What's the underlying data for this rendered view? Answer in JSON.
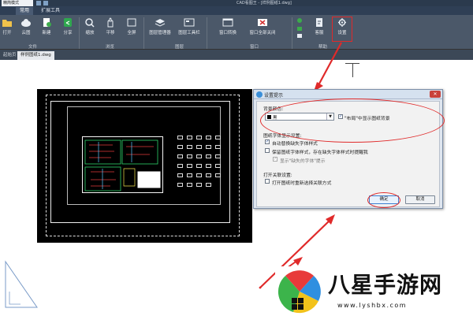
{
  "titlebar": {
    "dropdown_value": "精简模式",
    "title": "CAD看图王 - [样例图纸1.dwg]"
  },
  "ribbon_tabs": [
    {
      "label": "常用"
    },
    {
      "label": "扩展工具"
    }
  ],
  "ribbon": {
    "buttons": [
      {
        "label": "打开",
        "icon": "folder-icon"
      },
      {
        "label": "云图",
        "icon": "cloud-icon"
      },
      {
        "label": "新建",
        "icon": "new-file-icon"
      },
      {
        "label": "分享",
        "icon": "share-icon"
      },
      {
        "label": "缩放",
        "icon": "zoom-icon"
      },
      {
        "label": "平移",
        "icon": "hand-icon"
      },
      {
        "label": "全屏",
        "icon": "fullscreen-icon"
      },
      {
        "label": "图层管理器",
        "icon": "layers-icon"
      },
      {
        "label": "图层工具栏",
        "icon": "layer-toolbar-icon"
      },
      {
        "label": "窗口转换",
        "icon": "window-switch-icon"
      },
      {
        "label": "窗口全部关闭",
        "icon": "close-all-icon"
      },
      {
        "label": "客服",
        "icon": "support-icon"
      },
      {
        "label": "设置",
        "icon": "gear-icon"
      }
    ],
    "groups": [
      "文件",
      "浏览",
      "图层",
      "窗口",
      "帮助"
    ]
  },
  "doc_tabs": [
    {
      "label": "起始页"
    },
    {
      "label": "样例图纸1.dwg"
    }
  ],
  "dialog": {
    "title": "设置提示",
    "bg_color_label": "背景颜色:",
    "bg_color_value": "黑",
    "layout_check_label": "\"布局\"中显示图纸背景",
    "font_section_label": "图纸字体显示设置:",
    "auto_replace_label": "自动替换缺失字体样式",
    "keep_style_label": "保留图纸字体样式，存在缺失字体样式时提醒我",
    "show_missing_label": "显示\"缺失的字体\"提示",
    "open_section_label": "打开关联设置:",
    "reselect_label": "打开图纸时重新选择关联方式",
    "ok_label": "确定",
    "cancel_label": "取消"
  },
  "watermark": {
    "title": "八星手游网",
    "url": "www.lyshbx.com"
  },
  "colors": {
    "highlight": "#e02a2a",
    "ribbon": "#4b5869",
    "titlebar": "#2b3a4d",
    "drawing_bg": "#000000"
  }
}
